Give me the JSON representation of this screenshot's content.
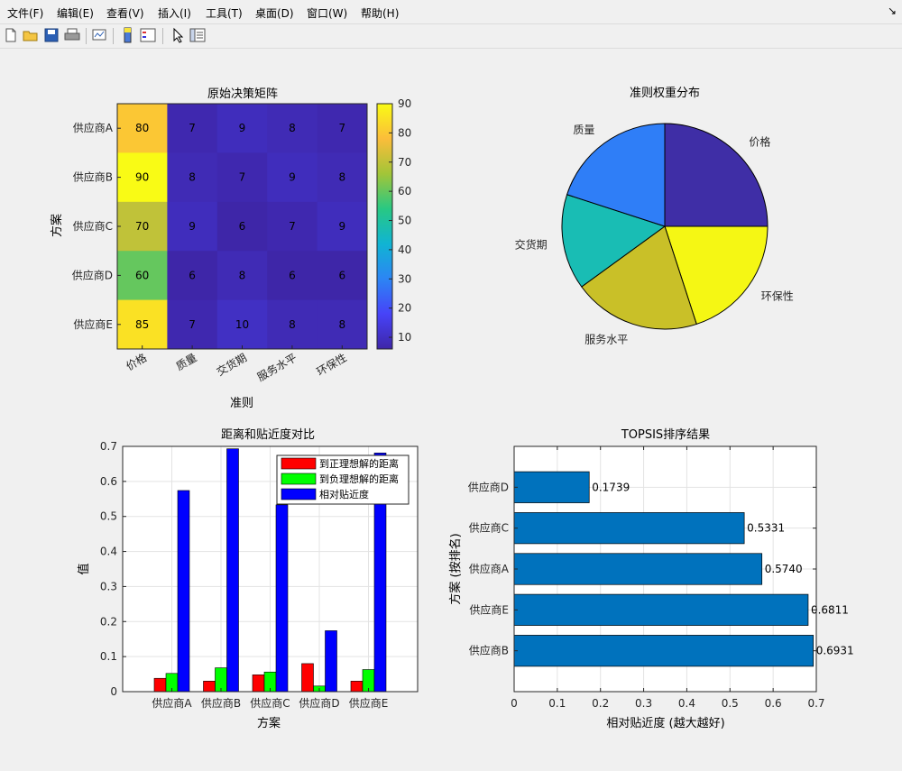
{
  "menu": {
    "items": [
      "文件(F)",
      "编辑(E)",
      "查看(V)",
      "插入(I)",
      "工具(T)",
      "桌面(D)",
      "窗口(W)",
      "帮助(H)"
    ],
    "arrow": "↘"
  },
  "toolbar": {
    "icons": [
      "new-file-icon",
      "open-folder-icon",
      "save-icon",
      "print-icon",
      "link-plot-icon",
      "colorbar-icon",
      "legend-icon",
      "pointer-icon",
      "property-inspector-icon"
    ]
  },
  "colors": {
    "parula": [
      "#3e26a8",
      "#4743f8",
      "#2c85f4",
      "#10b4d3",
      "#28c883",
      "#a2c538",
      "#fbbd3a",
      "#f9fb15"
    ],
    "red": "#ff0000",
    "green": "#00ff00",
    "blue": "#0000ff",
    "barh": "#0072bd"
  },
  "chart_data": [
    {
      "type": "heatmap",
      "title": "原始决策矩阵",
      "xlabel": "准则",
      "ylabel": "方案",
      "x": [
        "价格",
        "质量",
        "交货期",
        "服务水平",
        "环保性"
      ],
      "y": [
        "供应商A",
        "供应商B",
        "供应商C",
        "供应商D",
        "供应商E"
      ],
      "values": [
        [
          80,
          7,
          9,
          8,
          7
        ],
        [
          90,
          8,
          7,
          9,
          8
        ],
        [
          70,
          9,
          6,
          7,
          9
        ],
        [
          60,
          6,
          8,
          6,
          6
        ],
        [
          85,
          7,
          10,
          8,
          8
        ]
      ],
      "colorbar": {
        "ticks": [
          10,
          20,
          30,
          40,
          50,
          60,
          70,
          80,
          90
        ],
        "range": [
          6,
          90
        ]
      }
    },
    {
      "type": "pie",
      "title": "准则权重分布",
      "labels": [
        "价格",
        "环保性",
        "服务水平",
        "交货期",
        "质量"
      ],
      "values": [
        0.25,
        0.2,
        0.2,
        0.15,
        0.2
      ],
      "colors": [
        "#3f2ea6",
        "#f5f714",
        "#c9c028",
        "#19bdb4",
        "#2f7ef7"
      ]
    },
    {
      "type": "bar",
      "title": "距离和贴近度对比",
      "xlabel": "方案",
      "ylabel": "值",
      "categories": [
        "供应商A",
        "供应商B",
        "供应商C",
        "供应商D",
        "供应商E"
      ],
      "series": [
        {
          "name": "到正理想解的距离",
          "values": [
            0.038,
            0.03,
            0.048,
            0.08,
            0.03
          ]
        },
        {
          "name": "到负理想解的距离",
          "values": [
            0.052,
            0.068,
            0.056,
            0.016,
            0.063
          ]
        },
        {
          "name": "相对贴近度",
          "values": [
            0.574,
            0.6931,
            0.5331,
            0.1739,
            0.6811
          ]
        }
      ],
      "ylim": [
        0,
        0.7
      ],
      "yticks": [
        "0",
        "0.1",
        "0.2",
        "0.3",
        "0.4",
        "0.5",
        "0.6",
        "0.7"
      ],
      "grid": true,
      "legend": "top-right"
    },
    {
      "type": "barh",
      "title": "TOPSIS排序结果",
      "xlabel": "相对贴近度 (越大越好)",
      "ylabel": "方案 (按排名)",
      "categories": [
        "供应商B",
        "供应商E",
        "供应商A",
        "供应商C",
        "供应商D"
      ],
      "values": [
        0.6931,
        0.6811,
        0.574,
        0.5331,
        0.1739
      ],
      "labels": [
        "0.6931",
        "0.6811",
        "0.5740",
        "0.5331",
        "0.1739"
      ],
      "xlim": [
        0,
        0.7
      ],
      "xticks": [
        "0",
        "0.1",
        "0.2",
        "0.3",
        "0.4",
        "0.5",
        "0.6",
        "0.7"
      ],
      "grid": true
    }
  ]
}
